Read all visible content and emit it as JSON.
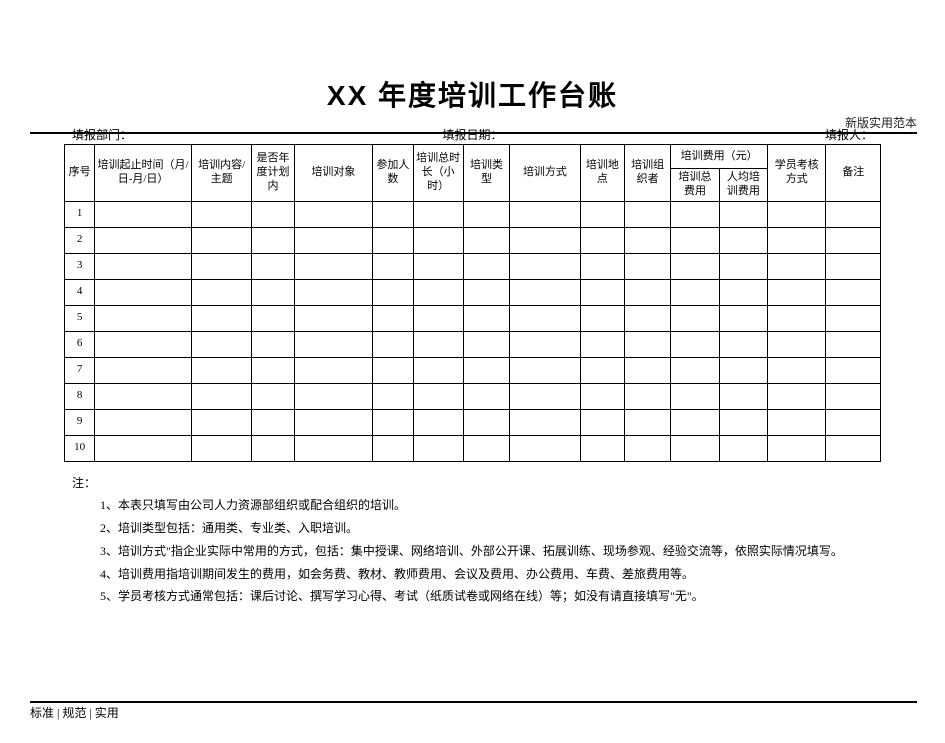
{
  "top_right_note": "新版实用范本",
  "title": "XX 年度培训工作台账",
  "meta": {
    "dept_label": "填报部门：",
    "date_label": "填报日期：",
    "person_label": "填报人："
  },
  "columns": {
    "seq": "序号",
    "time": "培训起止时间（月/日-月/日）",
    "topic": "培训内容/主题",
    "plan": "是否年度计划内",
    "target": "培训对象",
    "count": "参加人数",
    "hours": "培训总时长（小时）",
    "type": "培训类型",
    "method": "培训方式",
    "location": "培训地点",
    "organizer": "培训组织者",
    "fee_group": "培训费用（元）",
    "fee_total": "培训总费用",
    "fee_per": "人均培训费用",
    "exam": "学员考核方式",
    "remark": "备注"
  },
  "row_count": 10,
  "row_labels": [
    "1",
    "2",
    "3",
    "4",
    "5",
    "6",
    "7",
    "8",
    "9",
    "10"
  ],
  "notes": {
    "label": "注：",
    "items": [
      "1、本表只填写由公司人力资源部组织或配合组织的培训。",
      "2、培训类型包括：通用类、专业类、入职培训。",
      "3、培训方式\"指企业实际中常用的方式，包括：集中授课、网络培训、外部公开课、拓展训练、现场参观、经验交流等，依照实际情况填写。",
      "4、培训费用指培训期间发生的费用，如会务费、教材、教师费用、会议及费用、办公费用、车费、差旅费用等。",
      "5、学员考核方式通常包括：课后讨论、撰写学习心得、考试（纸质试卷或网络在线）等；如没有请直接填写\"无\"。"
    ]
  },
  "footer_left": "标准 | 规范 | 实用"
}
